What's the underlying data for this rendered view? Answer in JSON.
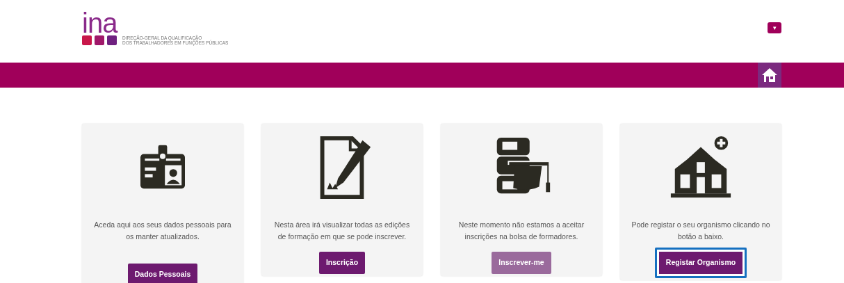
{
  "header": {
    "logo_text": "ina",
    "org_lines": [
      "DIREÇÃO-GERAL DA QUALIFICAÇÃO",
      "DOS TRABALHADORES EM FUNÇÕES PÚBLICAS"
    ],
    "menu_toggle": "▾"
  },
  "cards": [
    {
      "kind": "badge",
      "text": "Aceda aqui aos seus dados pessoais para os manter atualizados.",
      "button": "Dados Pessoais",
      "disabled": false,
      "focused": false
    },
    {
      "kind": "document",
      "text": "Nesta área irá visualizar todas as edições de formação em que se pode inscrever.",
      "button": "Inscrição",
      "disabled": false,
      "focused": false
    },
    {
      "kind": "training",
      "text": "Neste momento não estamos a aceitar inscrições na bolsa de formadores.",
      "button": "Inscrever-me",
      "disabled": true,
      "focused": false
    },
    {
      "kind": "building",
      "text": "Pode registar o seu organismo clicando no botão a baixo.",
      "button": "Registar Organismo",
      "disabled": false,
      "focused": true
    }
  ]
}
